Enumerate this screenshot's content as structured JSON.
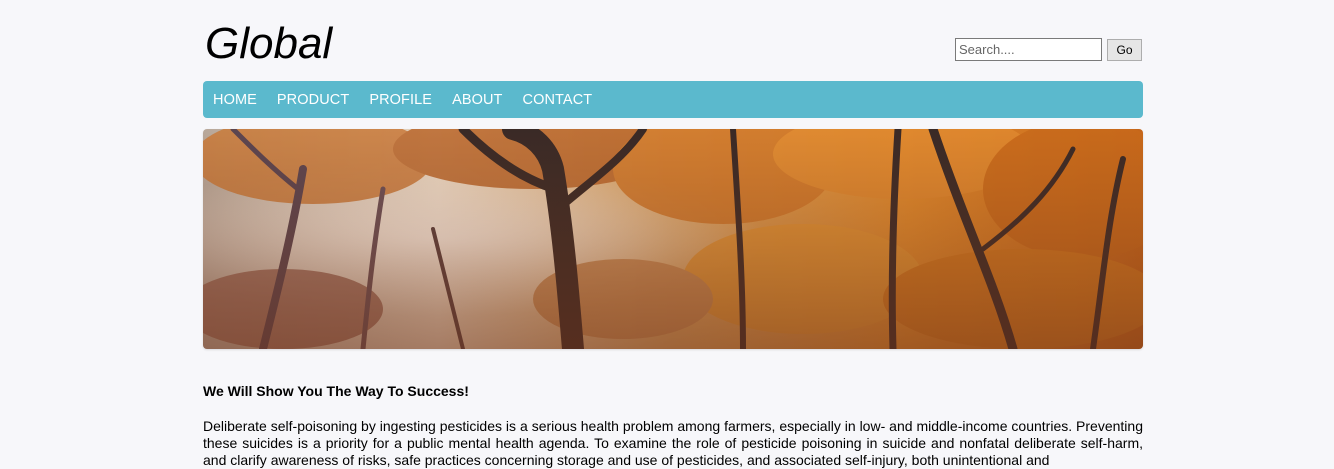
{
  "header": {
    "logo": "Global",
    "search": {
      "placeholder": "Search....",
      "value": ""
    },
    "go_label": "Go"
  },
  "nav": {
    "items": [
      {
        "label": "HOME"
      },
      {
        "label": "PRODUCT"
      },
      {
        "label": "PROFILE"
      },
      {
        "label": "ABOUT"
      },
      {
        "label": "CONTACT"
      }
    ]
  },
  "banner": {
    "icon": "autumn-forest-image"
  },
  "content": {
    "headline": "We Will Show You The Way To Success!",
    "paragraph": "Deliberate self-poisoning by ingesting pesticides is a serious health problem among farmers, especially in low- and middle-income countries. Preventing these suicides is a priority for a public mental health agenda. To examine the role of pesticide poisoning in suicide and nonfatal deliberate self-harm, and clarify awareness of risks, safe practices concerning storage and use of pesticides, and associated self-injury, both unintentional and"
  },
  "colors": {
    "background": "#f7f7fa",
    "nav_bar": "#5bb9cd",
    "nav_text": "#ffffff"
  }
}
